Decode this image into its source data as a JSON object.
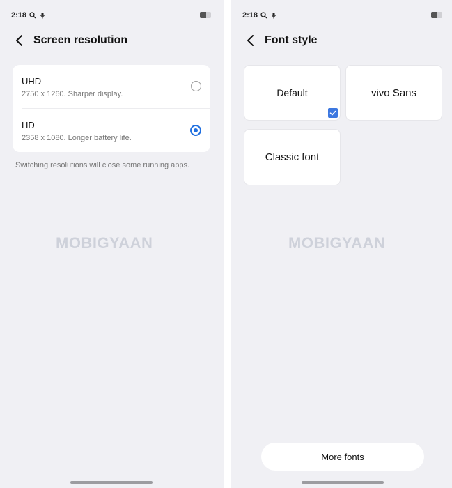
{
  "watermark": "MOBIGYAAN",
  "left": {
    "status": {
      "time": "2:18"
    },
    "header": {
      "title": "Screen resolution"
    },
    "options": [
      {
        "title": "UHD",
        "subtitle": "2750 x 1260. Sharper display.",
        "selected": false
      },
      {
        "title": "HD",
        "subtitle": "2358 x 1080. Longer battery life.",
        "selected": true
      }
    ],
    "note": "Switching resolutions will close some running apps."
  },
  "right": {
    "status": {
      "time": "2:18"
    },
    "header": {
      "title": "Font style"
    },
    "fonts": [
      {
        "label": "Default",
        "selected": true
      },
      {
        "label": "vivo Sans",
        "selected": false
      },
      {
        "label": "Classic font",
        "selected": false
      }
    ],
    "more_button": "More fonts"
  },
  "colors": {
    "accent": "#1f6fe0",
    "check": "#3d78e0",
    "background": "#f0f0f4"
  },
  "icons": [
    "back-arrow-icon",
    "search-icon",
    "mic-icon",
    "battery-icon",
    "radio-icon",
    "checkbox-icon"
  ]
}
